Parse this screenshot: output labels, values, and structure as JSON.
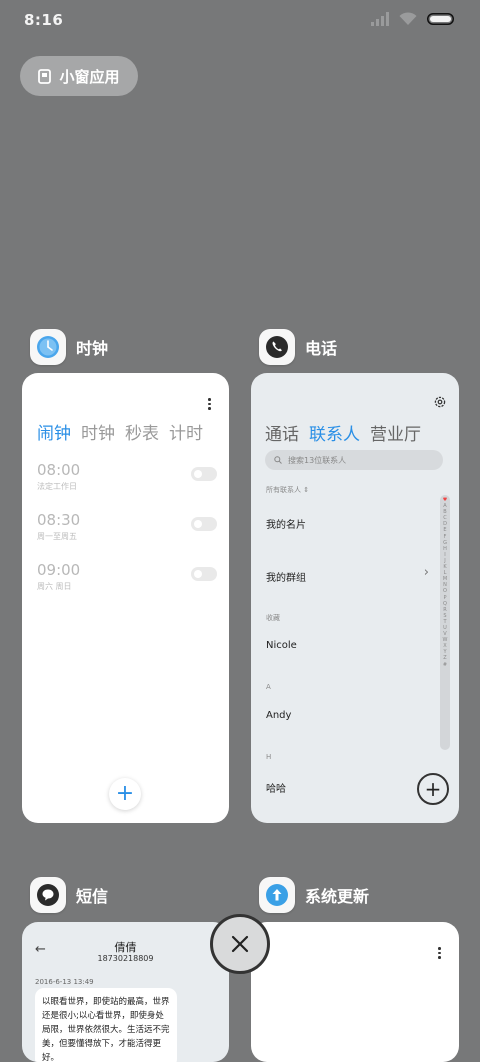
{
  "status": {
    "time": "8:16"
  },
  "small_window": {
    "label": "小窗应用"
  },
  "apps": {
    "clock": {
      "name": "时钟",
      "tabs": [
        "闹钟",
        "时钟",
        "秒表",
        "计时"
      ],
      "alarms": [
        {
          "time": "08:00",
          "desc": "法定工作日"
        },
        {
          "time": "08:30",
          "desc": "周一至周五"
        },
        {
          "time": "09:00",
          "desc": "周六 周日"
        }
      ],
      "add": "+"
    },
    "phone": {
      "name": "电话",
      "tabs": [
        "通话",
        "联系人",
        "营业厅"
      ],
      "search_placeholder": "搜索13位联系人",
      "filter": "所有联系人 ⇕",
      "my_card": "我的名片",
      "my_groups": "我的群组",
      "section_fav": "收藏",
      "c1": "Nicole",
      "section_a": "A",
      "c2": "Andy",
      "section_h": "H",
      "c3": "哈哈",
      "index": [
        "♥",
        "A",
        "B",
        "C",
        "D",
        "E",
        "F",
        "G",
        "H",
        "I",
        "J",
        "K",
        "L",
        "M",
        "N",
        "O",
        "P",
        "Q",
        "R",
        "S",
        "T",
        "U",
        "V",
        "W",
        "X",
        "Y",
        "Z",
        "#"
      ],
      "chevron": "›",
      "add": "+"
    },
    "sms": {
      "name": "短信",
      "back": "←",
      "contact": "倩倩",
      "number": "18730218809",
      "date": "2016-6-13 13:49",
      "message": "以眼看世界，即使站的最高，世界还是很小;以心看世界，即使身处局限，世界依然很大。生活远不完美，但要懂得放下，才能活得更好。"
    },
    "update": {
      "name": "系统更新"
    }
  },
  "colors": {
    "accent": "#2a8fe6",
    "background": "#777879"
  }
}
